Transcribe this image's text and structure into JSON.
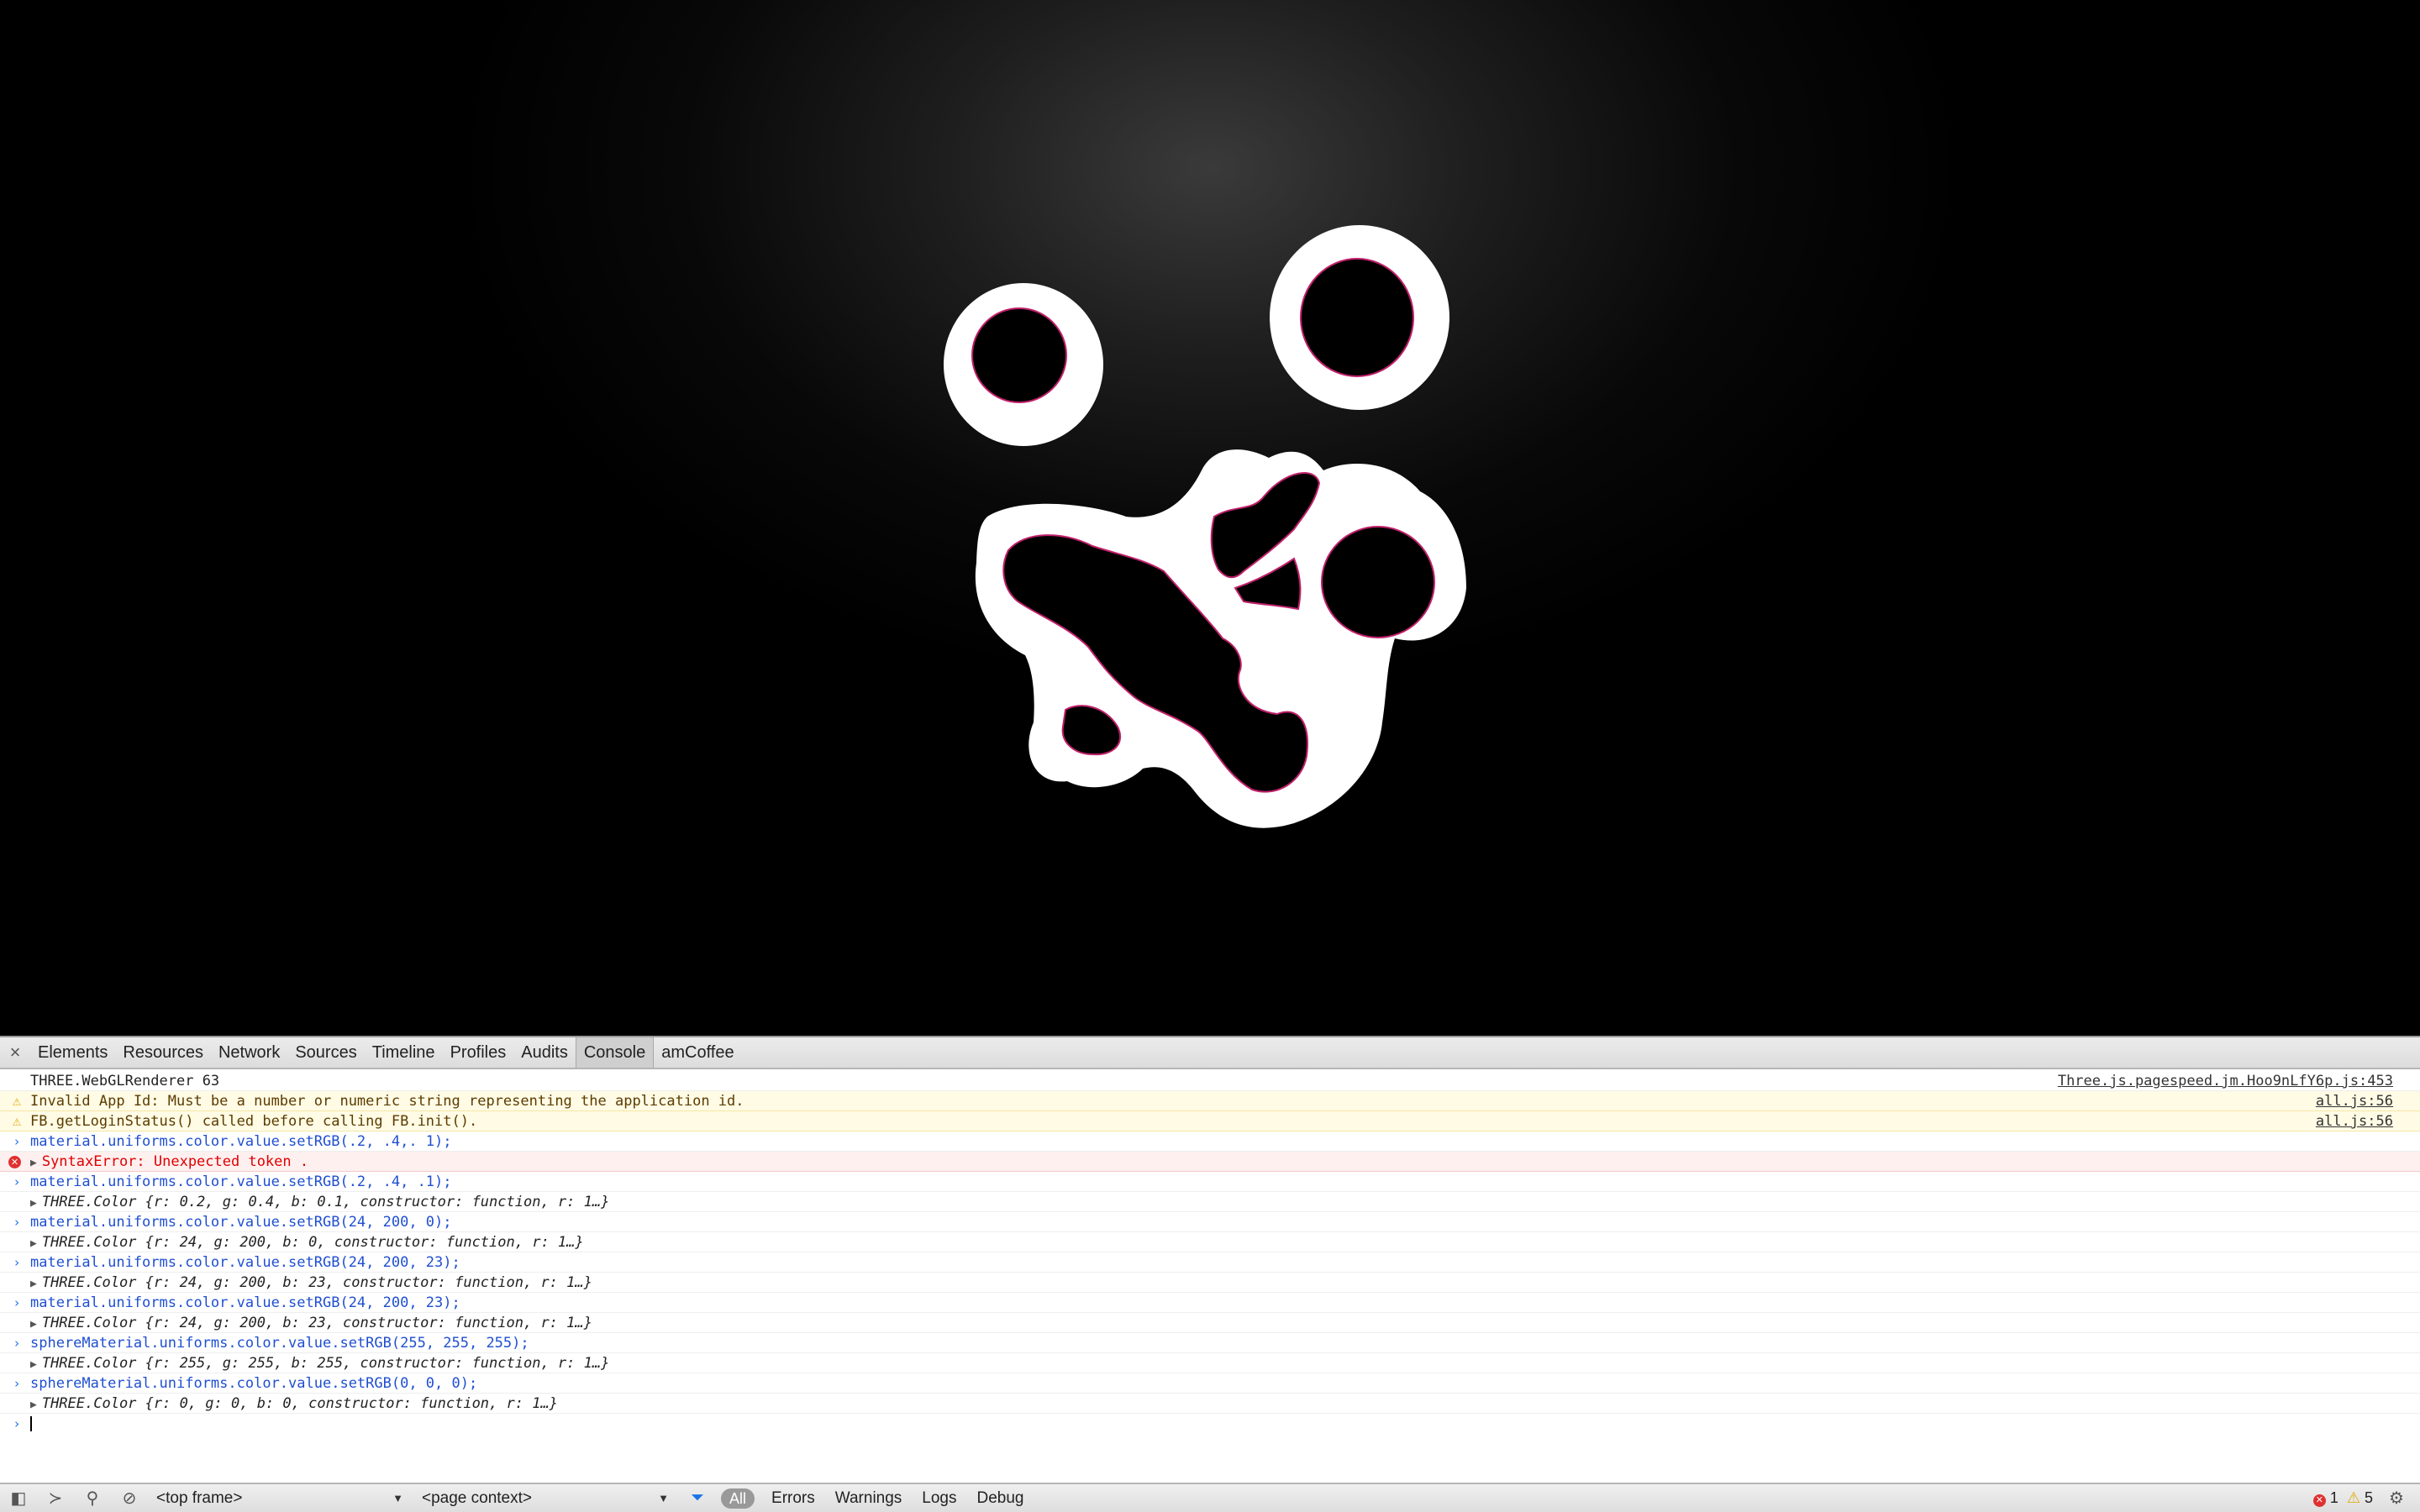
{
  "devtools": {
    "tabs": [
      "Elements",
      "Resources",
      "Network",
      "Sources",
      "Timeline",
      "Profiles",
      "Audits",
      "Console",
      "amCoffee"
    ],
    "active_tab": "Console",
    "close_icon": "×"
  },
  "console": {
    "lines": [
      {
        "type": "log",
        "text": "THREE.WebGLRenderer 63",
        "source": "Three.js.pagespeed.jm.Hoo9nLfY6p.js:453"
      },
      {
        "type": "warn",
        "text": "Invalid App Id: Must be a number or numeric string representing the application id.",
        "source": "all.js:56"
      },
      {
        "type": "warn",
        "text": "FB.getLoginStatus() called before calling FB.init().",
        "source": "all.js:56"
      },
      {
        "type": "cmd",
        "text": "material.uniforms.color.value.setRGB(.2, .4,. 1);"
      },
      {
        "type": "err",
        "text": "SyntaxError: Unexpected token ."
      },
      {
        "type": "cmd",
        "text": "material.uniforms.color.value.setRGB(.2, .4, .1);"
      },
      {
        "type": "res",
        "text": "THREE.Color {r: 0.2, g: 0.4, b: 0.1, constructor: function, r: 1…}"
      },
      {
        "type": "cmd",
        "text": "material.uniforms.color.value.setRGB(24, 200, 0);"
      },
      {
        "type": "res",
        "text": "THREE.Color {r: 24, g: 200, b: 0, constructor: function, r: 1…}"
      },
      {
        "type": "cmd",
        "text": "material.uniforms.color.value.setRGB(24, 200, 23);"
      },
      {
        "type": "res",
        "text": "THREE.Color {r: 24, g: 200, b: 23, constructor: function, r: 1…}"
      },
      {
        "type": "cmd",
        "text": "material.uniforms.color.value.setRGB(24, 200, 23);"
      },
      {
        "type": "res",
        "text": "THREE.Color {r: 24, g: 200, b: 23, constructor: function, r: 1…}"
      },
      {
        "type": "cmd",
        "text": "sphereMaterial.uniforms.color.value.setRGB(255, 255, 255);"
      },
      {
        "type": "res",
        "text": "THREE.Color {r: 255, g: 255, b: 255, constructor: function, r: 1…}"
      },
      {
        "type": "cmd",
        "text": "sphereMaterial.uniforms.color.value.setRGB(0, 0, 0);"
      },
      {
        "type": "res",
        "text": "THREE.Color {r: 0, g: 0, b: 0, constructor: function, r: 1…}"
      }
    ]
  },
  "statusbar": {
    "frame_select": "<top frame>",
    "context_select": "<page context>",
    "filter_all": "All",
    "filters": [
      "Errors",
      "Warnings",
      "Logs",
      "Debug"
    ],
    "error_count": "1",
    "warning_count": "5"
  },
  "colors": {
    "cmd_text": "#1f4fd1",
    "error_text": "#e00000",
    "warning_bg": "#fffbe5",
    "blob_fill": "#ffffff",
    "background": "#000000"
  }
}
